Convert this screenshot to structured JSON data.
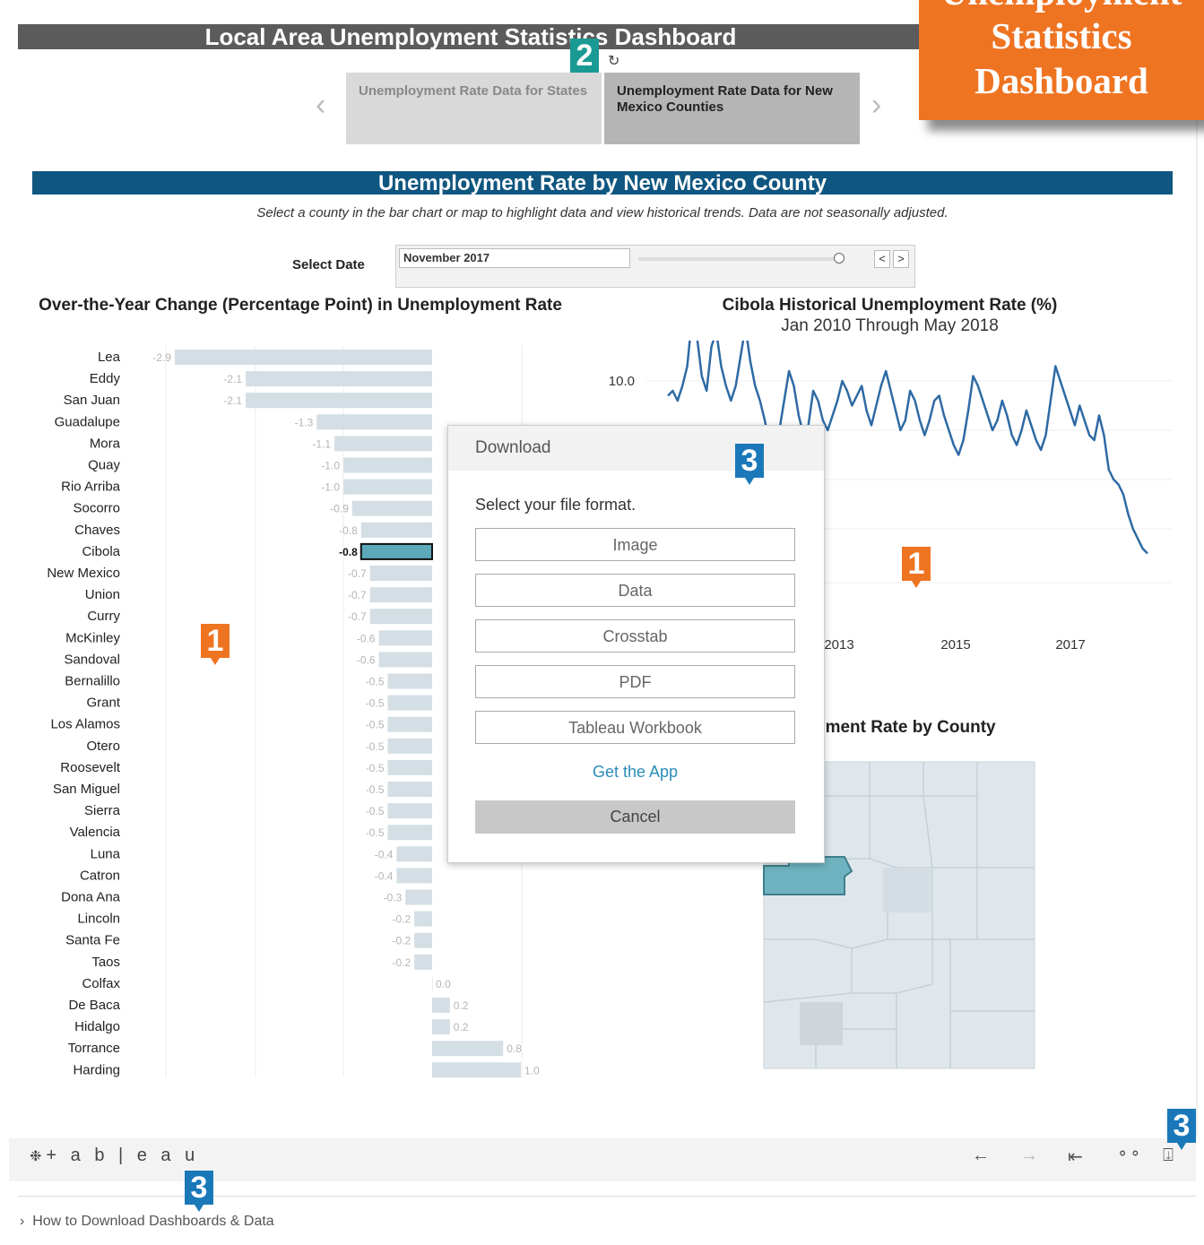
{
  "header": {
    "title": "Local Area Unemployment Statistics Dashboard"
  },
  "banner": {
    "line1": "Unemployment",
    "line2": "Statistics",
    "line3": "Dashboard"
  },
  "nav": {
    "tabs": [
      {
        "label": "Unemployment Rate Data for States"
      },
      {
        "label": "Unemployment Rate Data for New Mexico Counties"
      }
    ],
    "prev_icon": "chevron-left-icon",
    "next_icon": "chevron-right-icon",
    "refresh_icon": "refresh-icon"
  },
  "section": {
    "title": "Unemployment Rate by New Mexico County",
    "subtitle": "Select a county in the bar chart or map to highlight data and view historical trends. Data are not seasonally adjusted."
  },
  "date_filter": {
    "label": "Select Date",
    "value": "November 2017",
    "prev_label": "<",
    "next_label": ">"
  },
  "callouts": {
    "one": "1",
    "two": "2",
    "three": "3"
  },
  "colors": {
    "orange": "#ef7422",
    "teal": "#1a9a94",
    "blue": "#1a78b9",
    "bar": "#d4dee5",
    "highlight": "#5ba9bb",
    "line": "#2e6aa4",
    "header": "#0f5680"
  },
  "chart_data": [
    {
      "type": "bar",
      "title": "Over-the-Year Change (Percentage Point) in Unemployment Rate",
      "categories": [
        "Lea",
        "Eddy",
        "San Juan",
        "Guadalupe",
        "Mora",
        "Quay",
        "Rio Arriba",
        "Socorro",
        "Chaves",
        "Cibola",
        "New Mexico",
        "Union",
        "Curry",
        "McKinley",
        "Sandoval",
        "Bernalillo",
        "Grant",
        "Los Alamos",
        "Otero",
        "Roosevelt",
        "San Miguel",
        "Sierra",
        "Valencia",
        "Luna",
        "Catron",
        "Dona Ana",
        "Lincoln",
        "Santa Fe",
        "Taos",
        "Colfax",
        "De Baca",
        "Hidalgo",
        "Torrance",
        "Harding"
      ],
      "values": [
        -2.9,
        -2.1,
        -2.1,
        -1.3,
        -1.1,
        -1.0,
        -1.0,
        -0.9,
        -0.8,
        -0.8,
        -0.7,
        -0.7,
        -0.7,
        -0.6,
        -0.6,
        -0.5,
        -0.5,
        -0.5,
        -0.5,
        -0.5,
        -0.5,
        -0.5,
        -0.5,
        -0.4,
        -0.4,
        -0.3,
        -0.2,
        -0.2,
        -0.2,
        0.0,
        0.2,
        0.2,
        0.8,
        1.0
      ],
      "labels": [
        "-2.9",
        "-2.1",
        "-2.1",
        "-1.3",
        "-1.1",
        "-1.0",
        "-1.0",
        "-0.9",
        "-0.8",
        "-0.8",
        "-0.7",
        "-0.7",
        "-0.7",
        "-0.6",
        "-0.6",
        "-0.5",
        "-0.5",
        "-0.5",
        "-0.5",
        "-0.5",
        "-0.5",
        "-0.5",
        "-0.5",
        "-0.4",
        "-0.4",
        "-0.3",
        "-0.2",
        "-0.2",
        "-0.2",
        "0.0",
        "0.2",
        "0.2",
        "0.8",
        "1.0"
      ],
      "highlight": "Cibola"
    },
    {
      "type": "line",
      "title": "Cibola Historical Unemployment Rate (%)",
      "subtitle": "Jan 2010 Through May 2018",
      "x_tick_labels": [
        "2013",
        "2015",
        "2017"
      ],
      "y_tick_labels": [
        "10.0"
      ],
      "series": [
        {
          "values": [
            9.7,
            9.8,
            9.6,
            9.9,
            10.3,
            11.3,
            10.9,
            10.1,
            9.8,
            10.7,
            11.0,
            10.3,
            9.9,
            9.6,
            9.9,
            10.5,
            11.1,
            10.4,
            9.9,
            9.6,
            9.2,
            8.7,
            8.5,
            9.0,
            9.6,
            10.2,
            9.9,
            9.3,
            8.9,
            9.1,
            9.8,
            9.6,
            9.2,
            9.0,
            9.3,
            9.6,
            10.0,
            9.8,
            9.5,
            9.7,
            9.9,
            9.4,
            9.1,
            9.5,
            9.9,
            10.2,
            9.8,
            9.4,
            9.0,
            9.2,
            9.8,
            9.6,
            9.2,
            8.9,
            9.2,
            9.6,
            9.7,
            9.3,
            9.0,
            8.7,
            8.5,
            8.8,
            9.4,
            10.1,
            9.9,
            9.6,
            9.3,
            9.0,
            9.2,
            9.6,
            9.3,
            8.9,
            8.7,
            9.0,
            9.4,
            9.1,
            8.8,
            8.6,
            8.9,
            9.6,
            10.3,
            10.0,
            9.7,
            9.4,
            9.1,
            9.5,
            9.2,
            8.9,
            8.8,
            9.3,
            8.9,
            8.2,
            8.0,
            7.9,
            7.7,
            7.3,
            7.0,
            6.8,
            6.6,
            6.5
          ]
        }
      ]
    }
  ],
  "map": {
    "title": "Unemployment Rate by County",
    "visible_title": "yment Rate by County"
  },
  "dialog": {
    "title": "Download",
    "prompt": "Select your file format.",
    "options": [
      "Image",
      "Data",
      "Crosstab",
      "PDF",
      "Tableau Workbook"
    ],
    "get_app": "Get the App",
    "cancel": "Cancel"
  },
  "toolbar": {
    "logo": "+ a b | e a u",
    "icons": [
      "undo-icon",
      "redo-icon",
      "revert-icon",
      "share-icon",
      "download-icon"
    ]
  },
  "footer": {
    "link": "How to Download Dashboards & Data"
  }
}
